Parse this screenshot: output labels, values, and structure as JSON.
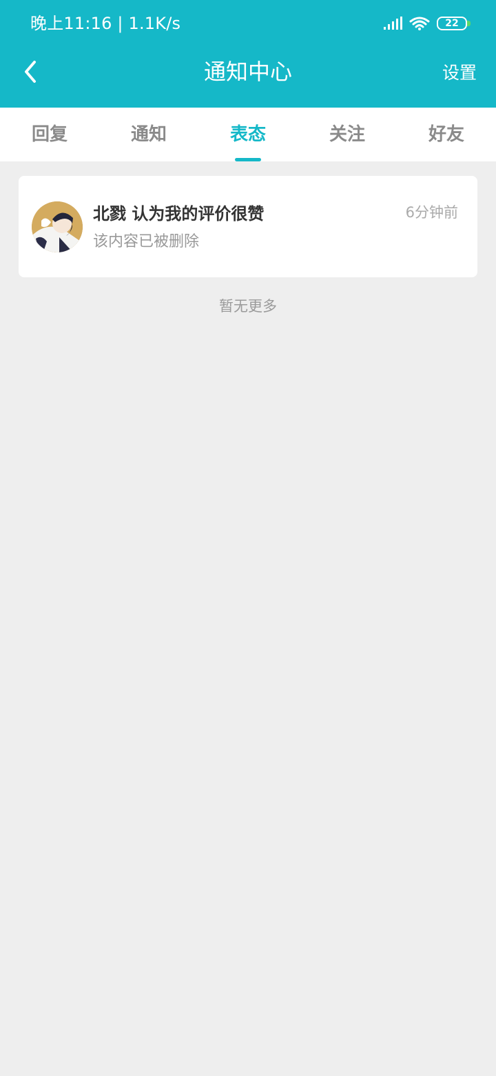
{
  "status_bar": {
    "time_speed": "晚上11:16 | 1.1K/s",
    "battery": "22",
    "icons": [
      "signal-icon",
      "wifi-icon",
      "battery-icon"
    ]
  },
  "header": {
    "title": "通知中心",
    "settings_label": "设置",
    "back_icon": "chevron-left-icon"
  },
  "tabs": [
    {
      "label": "回复",
      "active": false
    },
    {
      "label": "通知",
      "active": false
    },
    {
      "label": "表态",
      "active": true
    },
    {
      "label": "关注",
      "active": false
    },
    {
      "label": "好友",
      "active": false
    }
  ],
  "notifications": [
    {
      "title": "北戮 认为我的评价很赞",
      "time": "6分钟前",
      "subtitle": "该内容已被删除"
    }
  ],
  "footer": {
    "no_more": "暂无更多"
  },
  "colors": {
    "accent": "#15b8c8",
    "background": "#eeeeee",
    "card": "#ffffff",
    "tab_inactive": "#8a8a8a"
  }
}
